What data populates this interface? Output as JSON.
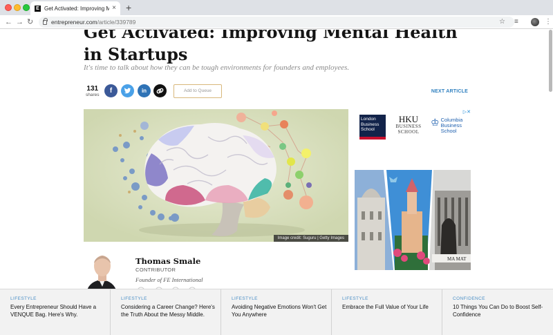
{
  "browser": {
    "tab_title": "Get Activated: Improving Menta",
    "tab_close": "×",
    "new_tab": "+",
    "url_host": "entrepreneur.com",
    "url_path": "/article/339789",
    "favicon_letter": "E"
  },
  "article": {
    "headline": "Get Activated: Improving Mental Health in Startups",
    "subhead": "It's time to talk about how they can be tough environments for founders and employees.",
    "share_count": "131",
    "share_label": "shares",
    "queue_label": "Add to Queue",
    "next_label": "NEXT ARTICLE",
    "image_credit": "Image credit: Suguru | Getty Images"
  },
  "ads": {
    "ad_flag": "▷✕",
    "lbs": "London Business School",
    "hku_top": "HKU",
    "hku_bottom": "BUSINESS SCHOOL",
    "columbia": "Columbia Business School",
    "photo_sign": "MA MAT"
  },
  "author": {
    "name": "Thomas Smale",
    "role": "CONTRIBUTOR",
    "bio": "Founder of FE International"
  },
  "recommendations": [
    {
      "category": "LIFESTYLE",
      "title": "Every Entrepreneur Should Have a VENQUE Bag. Here's Why."
    },
    {
      "category": "LIFESTYLE",
      "title": "Considering a Career Change? Here's the Truth About the Messy Middle."
    },
    {
      "category": "LIFESTYLE",
      "title": "Avoiding Negative Emotions Won't Get You Anywhere"
    },
    {
      "category": "LIFESTYLE",
      "title": "Embrace the Full Value of Your Life"
    },
    {
      "category": "CONFIDENCE",
      "title": "10 Things You Can Do to Boost Self-Confidence"
    }
  ],
  "colors": {
    "facebook": "#3b5998",
    "twitter": "#4aa1e8",
    "linkedin": "#2f73b6",
    "accent_link": "#2e7fbf"
  }
}
